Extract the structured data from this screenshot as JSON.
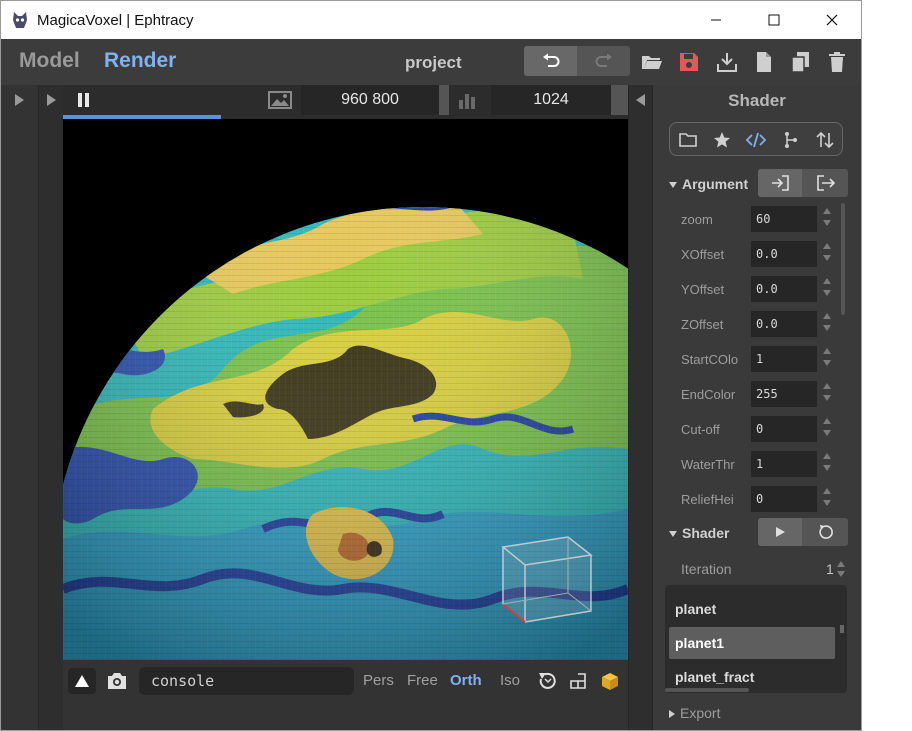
{
  "window": {
    "title": "MagicaVoxel | Ephtracy",
    "minimize": "—",
    "maximize": "☐",
    "close": "✕"
  },
  "menu": {
    "model_tab": "Model",
    "render_tab": "Render",
    "project": "project",
    "accent_color": "#7fb2ee"
  },
  "render_toolbar": {
    "resolution": "960  800",
    "samples": "1024",
    "progress_fraction": 0.28
  },
  "bottom": {
    "console": "console",
    "modes": [
      "Pers",
      "Free",
      "Orth",
      "Iso"
    ],
    "active_mode": "Orth"
  },
  "panel": {
    "title": "Shader",
    "argument_section": "Argument",
    "arguments": [
      {
        "label": "zoom",
        "value": "60"
      },
      {
        "label": "XOffset",
        "value": "0.0"
      },
      {
        "label": "YOffset",
        "value": "0.0"
      },
      {
        "label": "ZOffset",
        "value": "0.0"
      },
      {
        "label": "StartCOlo",
        "value": "1"
      },
      {
        "label": "EndColor",
        "value": "255"
      },
      {
        "label": "Cut-off",
        "value": "0"
      },
      {
        "label": "WaterThr",
        "value": "1"
      },
      {
        "label": "ReliefHei",
        "value": "0"
      }
    ],
    "shader_section": "Shader",
    "iteration_label": "Iteration",
    "iteration_value": "1",
    "shaders": [
      "planet",
      "planet1",
      "planet_fract"
    ],
    "selected_shader": "planet1",
    "export_section": "Export"
  }
}
